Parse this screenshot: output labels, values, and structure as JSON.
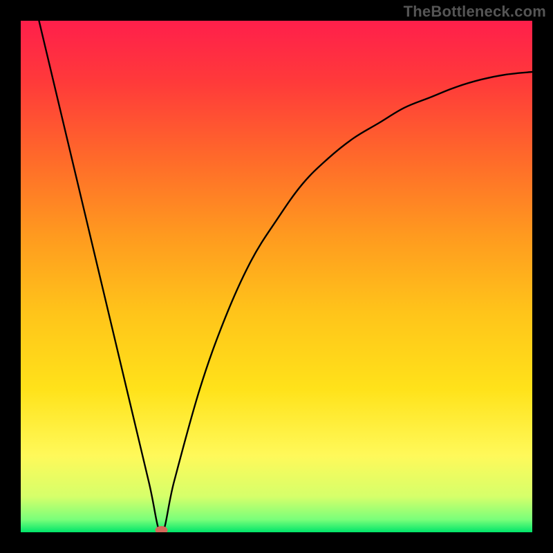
{
  "watermark": "TheBottleneck.com",
  "chart_data": {
    "type": "line",
    "title": "",
    "xlabel": "",
    "ylabel": "",
    "xlim": [
      0,
      100
    ],
    "ylim": [
      0,
      100
    ],
    "grid": false,
    "legend": false,
    "background": {
      "type": "vertical-gradient",
      "stops": [
        {
          "pos": 0.0,
          "color": "#ff1f4b"
        },
        {
          "pos": 0.12,
          "color": "#ff3a3a"
        },
        {
          "pos": 0.27,
          "color": "#ff6a2a"
        },
        {
          "pos": 0.42,
          "color": "#ff9a1f"
        },
        {
          "pos": 0.57,
          "color": "#ffc41a"
        },
        {
          "pos": 0.72,
          "color": "#ffe21a"
        },
        {
          "pos": 0.85,
          "color": "#fff95a"
        },
        {
          "pos": 0.93,
          "color": "#d6ff6a"
        },
        {
          "pos": 0.975,
          "color": "#7aff7a"
        },
        {
          "pos": 1.0,
          "color": "#00e56a"
        }
      ]
    },
    "marker": {
      "x": 27.5,
      "y": 0,
      "color": "#d46a5a"
    },
    "series": [
      {
        "name": "curve",
        "color": "#000000",
        "x": [
          0,
          5,
          10,
          15,
          20,
          25,
          27.5,
          30,
          35,
          40,
          45,
          50,
          55,
          60,
          65,
          70,
          75,
          80,
          85,
          90,
          95,
          100
        ],
        "y": [
          115,
          94,
          73,
          52,
          31,
          10,
          0,
          10,
          28,
          42,
          53,
          61,
          68,
          73,
          77,
          80,
          83,
          85,
          87,
          88.5,
          89.5,
          90
        ]
      }
    ]
  }
}
